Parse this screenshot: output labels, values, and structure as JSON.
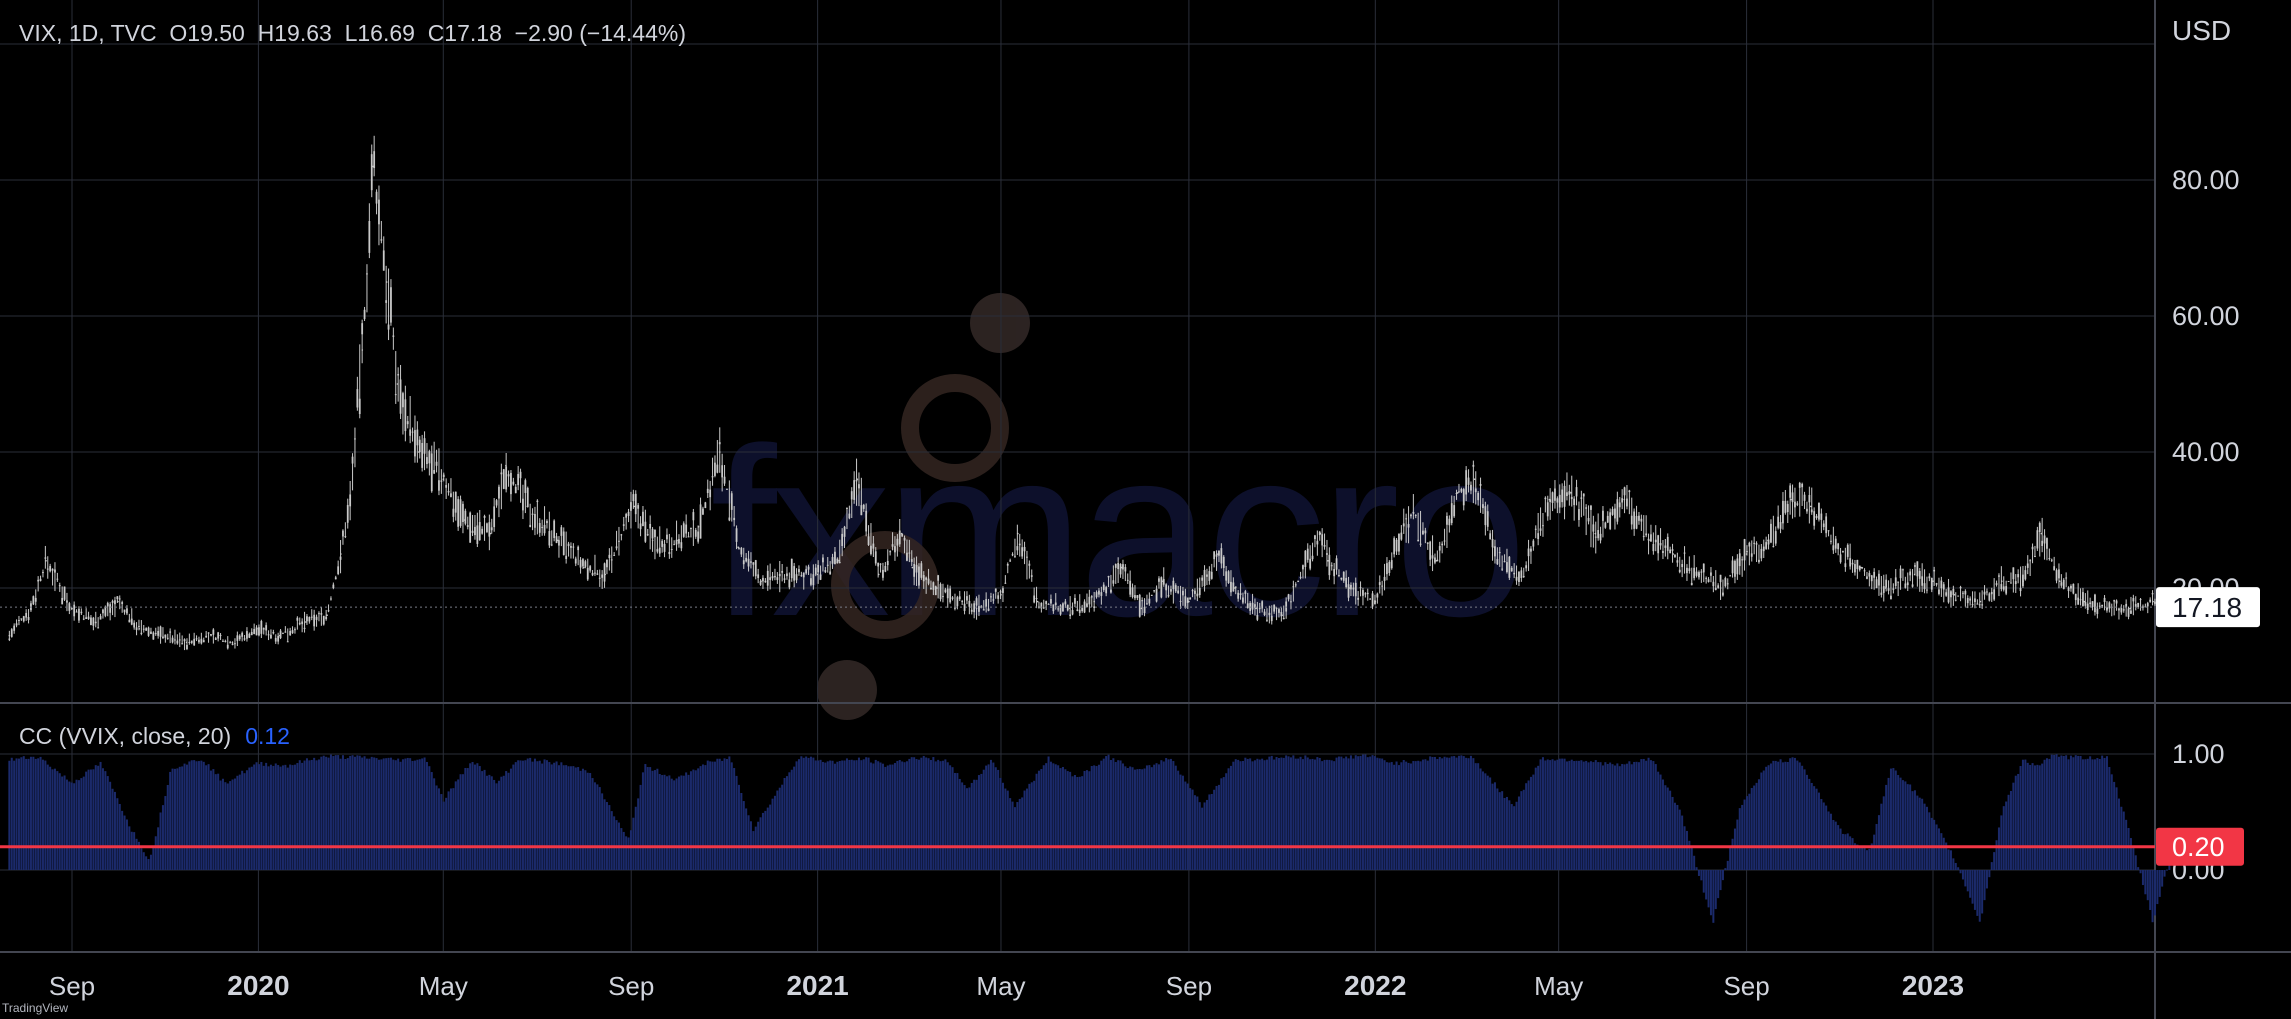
{
  "header": {
    "symbol_line": "VIX, 1D, TVC  O19.50  H19.63  L16.69  C17.18  −2.90 (−14.44%)"
  },
  "indicator": {
    "label": "CC (VVIX, close, 20)",
    "value": "0.12"
  },
  "watermark": {
    "text": "fxmacro"
  },
  "branding": {
    "text": "TradingView"
  },
  "colors": {
    "background": "#000000",
    "grid": "#2a2e39",
    "candles": "#c9c9c9",
    "histogram": "#1b2a6b",
    "reference_line": "#f23645",
    "indicator_value": "#2962ff",
    "last_price_label_bg": "#ffffff"
  },
  "chart_data": [
    {
      "type": "line",
      "title": "VIX, 1D, TVC",
      "currency": "USD",
      "ylim": [
        0,
        100
      ],
      "y_ticks": [
        20,
        40,
        60,
        80
      ],
      "y_tick_labels": [
        "20.00",
        "40.00",
        "60.00",
        "80.00"
      ],
      "last_value": 17.18,
      "last_value_label": "17.18",
      "x_tick_labels": [
        "Sep",
        "2020",
        "May",
        "Sep",
        "2021",
        "May",
        "Sep",
        "2022",
        "May",
        "Sep",
        "2023"
      ],
      "x_tick_dates": [
        "2019-09-01",
        "2020-01-01",
        "2020-05-01",
        "2020-09-01",
        "2021-01-01",
        "2021-05-01",
        "2021-09-01",
        "2022-01-01",
        "2022-05-01",
        "2022-09-01",
        "2023-01-01"
      ],
      "series": [
        {
          "name": "VIX",
          "x": [
            "2019-07-22",
            "2019-08-05",
            "2019-08-15",
            "2019-09-01",
            "2019-09-15",
            "2019-10-01",
            "2019-10-15",
            "2019-11-01",
            "2019-11-15",
            "2019-12-01",
            "2019-12-15",
            "2020-01-01",
            "2020-01-15",
            "2020-02-01",
            "2020-02-15",
            "2020-02-24",
            "2020-03-01",
            "2020-03-09",
            "2020-03-16",
            "2020-03-25",
            "2020-04-01",
            "2020-04-15",
            "2020-05-01",
            "2020-05-15",
            "2020-06-01",
            "2020-06-11",
            "2020-06-25",
            "2020-07-15",
            "2020-08-01",
            "2020-08-15",
            "2020-09-03",
            "2020-09-15",
            "2020-10-01",
            "2020-10-15",
            "2020-10-29",
            "2020-11-10",
            "2020-11-25",
            "2020-12-15",
            "2021-01-01",
            "2021-01-15",
            "2021-01-27",
            "2021-02-10",
            "2021-02-25",
            "2021-03-04",
            "2021-03-20",
            "2021-04-15",
            "2021-05-01",
            "2021-05-12",
            "2021-05-25",
            "2021-06-15",
            "2021-07-01",
            "2021-07-19",
            "2021-08-01",
            "2021-08-15",
            "2021-09-01",
            "2021-09-20",
            "2021-10-01",
            "2021-10-15",
            "2021-11-01",
            "2021-11-26",
            "2021-12-01",
            "2021-12-15",
            "2022-01-01",
            "2022-01-15",
            "2022-01-26",
            "2022-02-10",
            "2022-02-24",
            "2022-03-07",
            "2022-03-20",
            "2022-04-05",
            "2022-04-25",
            "2022-05-09",
            "2022-05-25",
            "2022-06-13",
            "2022-06-30",
            "2022-07-15",
            "2022-08-01",
            "2022-08-15",
            "2022-09-01",
            "2022-09-15",
            "2022-09-30",
            "2022-10-13",
            "2022-10-31",
            "2022-11-15",
            "2022-12-01",
            "2022-12-20",
            "2023-01-01",
            "2023-01-15",
            "2023-02-01",
            "2023-02-15",
            "2023-03-01",
            "2023-03-13",
            "2023-03-25",
            "2023-04-10",
            "2023-04-25",
            "2023-05-10",
            "2023-05-25",
            "2023-06-05"
          ],
          "y": [
            13,
            17,
            24,
            17,
            15,
            18,
            14,
            13,
            12,
            13,
            12,
            14,
            13,
            15,
            16,
            25,
            33,
            55,
            82,
            65,
            50,
            40,
            36,
            30,
            28,
            38,
            32,
            27,
            23,
            22,
            32,
            27,
            27,
            29,
            40,
            26,
            21,
            22,
            22,
            24,
            36,
            22,
            28,
            23,
            20,
            17,
            19,
            28,
            18,
            17,
            18,
            23,
            17,
            21,
            18,
            25,
            20,
            17,
            16,
            28,
            24,
            20,
            18,
            27,
            31,
            24,
            34,
            36,
            26,
            21,
            33,
            34,
            28,
            33,
            27,
            25,
            22,
            20,
            25,
            27,
            33,
            32,
            26,
            23,
            20,
            22,
            21,
            19,
            18,
            21,
            21,
            28,
            21,
            18,
            17,
            17,
            18,
            17.18
          ]
        }
      ]
    },
    {
      "type": "bar",
      "title": "CC (VVIX, close, 20)",
      "ylim": [
        -0.55,
        1.2
      ],
      "y_ticks": [
        0,
        1
      ],
      "y_tick_labels": [
        "0.00",
        "1.00"
      ],
      "reference_value": 0.2,
      "reference_label": "0.20",
      "last_value": 0.12,
      "x": [
        "2019-07-22",
        "2019-08-10",
        "2019-09-01",
        "2019-09-20",
        "2019-10-10",
        "2019-10-22",
        "2019-11-05",
        "2019-11-25",
        "2019-12-10",
        "2020-01-01",
        "2020-01-20",
        "2020-02-03",
        "2020-02-15",
        "2020-03-10",
        "2020-04-01",
        "2020-04-20",
        "2020-05-01",
        "2020-05-20",
        "2020-06-05",
        "2020-06-20",
        "2020-07-15",
        "2020-08-05",
        "2020-08-30",
        "2020-09-10",
        "2020-10-01",
        "2020-10-20",
        "2020-11-05",
        "2020-11-20",
        "2020-12-20",
        "2021-01-10",
        "2021-02-01",
        "2021-02-15",
        "2021-03-05",
        "2021-03-25",
        "2021-04-10",
        "2021-04-25",
        "2021-05-10",
        "2021-06-01",
        "2021-06-20",
        "2021-07-10",
        "2021-07-30",
        "2021-08-20",
        "2021-09-10",
        "2021-10-01",
        "2021-10-20",
        "2021-11-10",
        "2021-12-01",
        "2021-12-25",
        "2022-01-15",
        "2022-02-10",
        "2022-03-05",
        "2022-04-01",
        "2022-04-20",
        "2022-05-15",
        "2022-06-10",
        "2022-07-01",
        "2022-07-20",
        "2022-08-10",
        "2022-08-28",
        "2022-09-15",
        "2022-10-05",
        "2022-11-01",
        "2022-11-20",
        "2022-12-05",
        "2022-12-25",
        "2023-01-15",
        "2023-02-01",
        "2023-02-15",
        "2023-03-01",
        "2023-03-10",
        "2023-03-20",
        "2023-04-05",
        "2023-04-25",
        "2023-05-10",
        "2023-05-25",
        "2023-06-05"
      ],
      "values": [
        0.95,
        0.98,
        0.75,
        0.92,
        0.35,
        0.08,
        0.88,
        0.96,
        0.75,
        0.92,
        0.9,
        0.95,
        0.98,
        0.97,
        0.95,
        0.96,
        0.6,
        0.95,
        0.75,
        0.96,
        0.92,
        0.85,
        0.25,
        0.9,
        0.78,
        0.92,
        0.97,
        0.35,
        0.98,
        0.93,
        0.96,
        0.9,
        0.97,
        0.95,
        0.7,
        0.96,
        0.55,
        0.96,
        0.8,
        0.98,
        0.85,
        0.97,
        0.55,
        0.95,
        0.96,
        0.98,
        0.95,
        0.99,
        0.92,
        0.97,
        0.98,
        0.55,
        0.96,
        0.95,
        0.9,
        0.96,
        0.5,
        -0.45,
        0.55,
        0.92,
        0.96,
        0.35,
        0.15,
        0.9,
        0.6,
        0.1,
        -0.45,
        0.5,
        0.95,
        0.9,
        0.98,
        0.97,
        0.97,
        0.3,
        -0.45,
        0.12
      ]
    }
  ]
}
